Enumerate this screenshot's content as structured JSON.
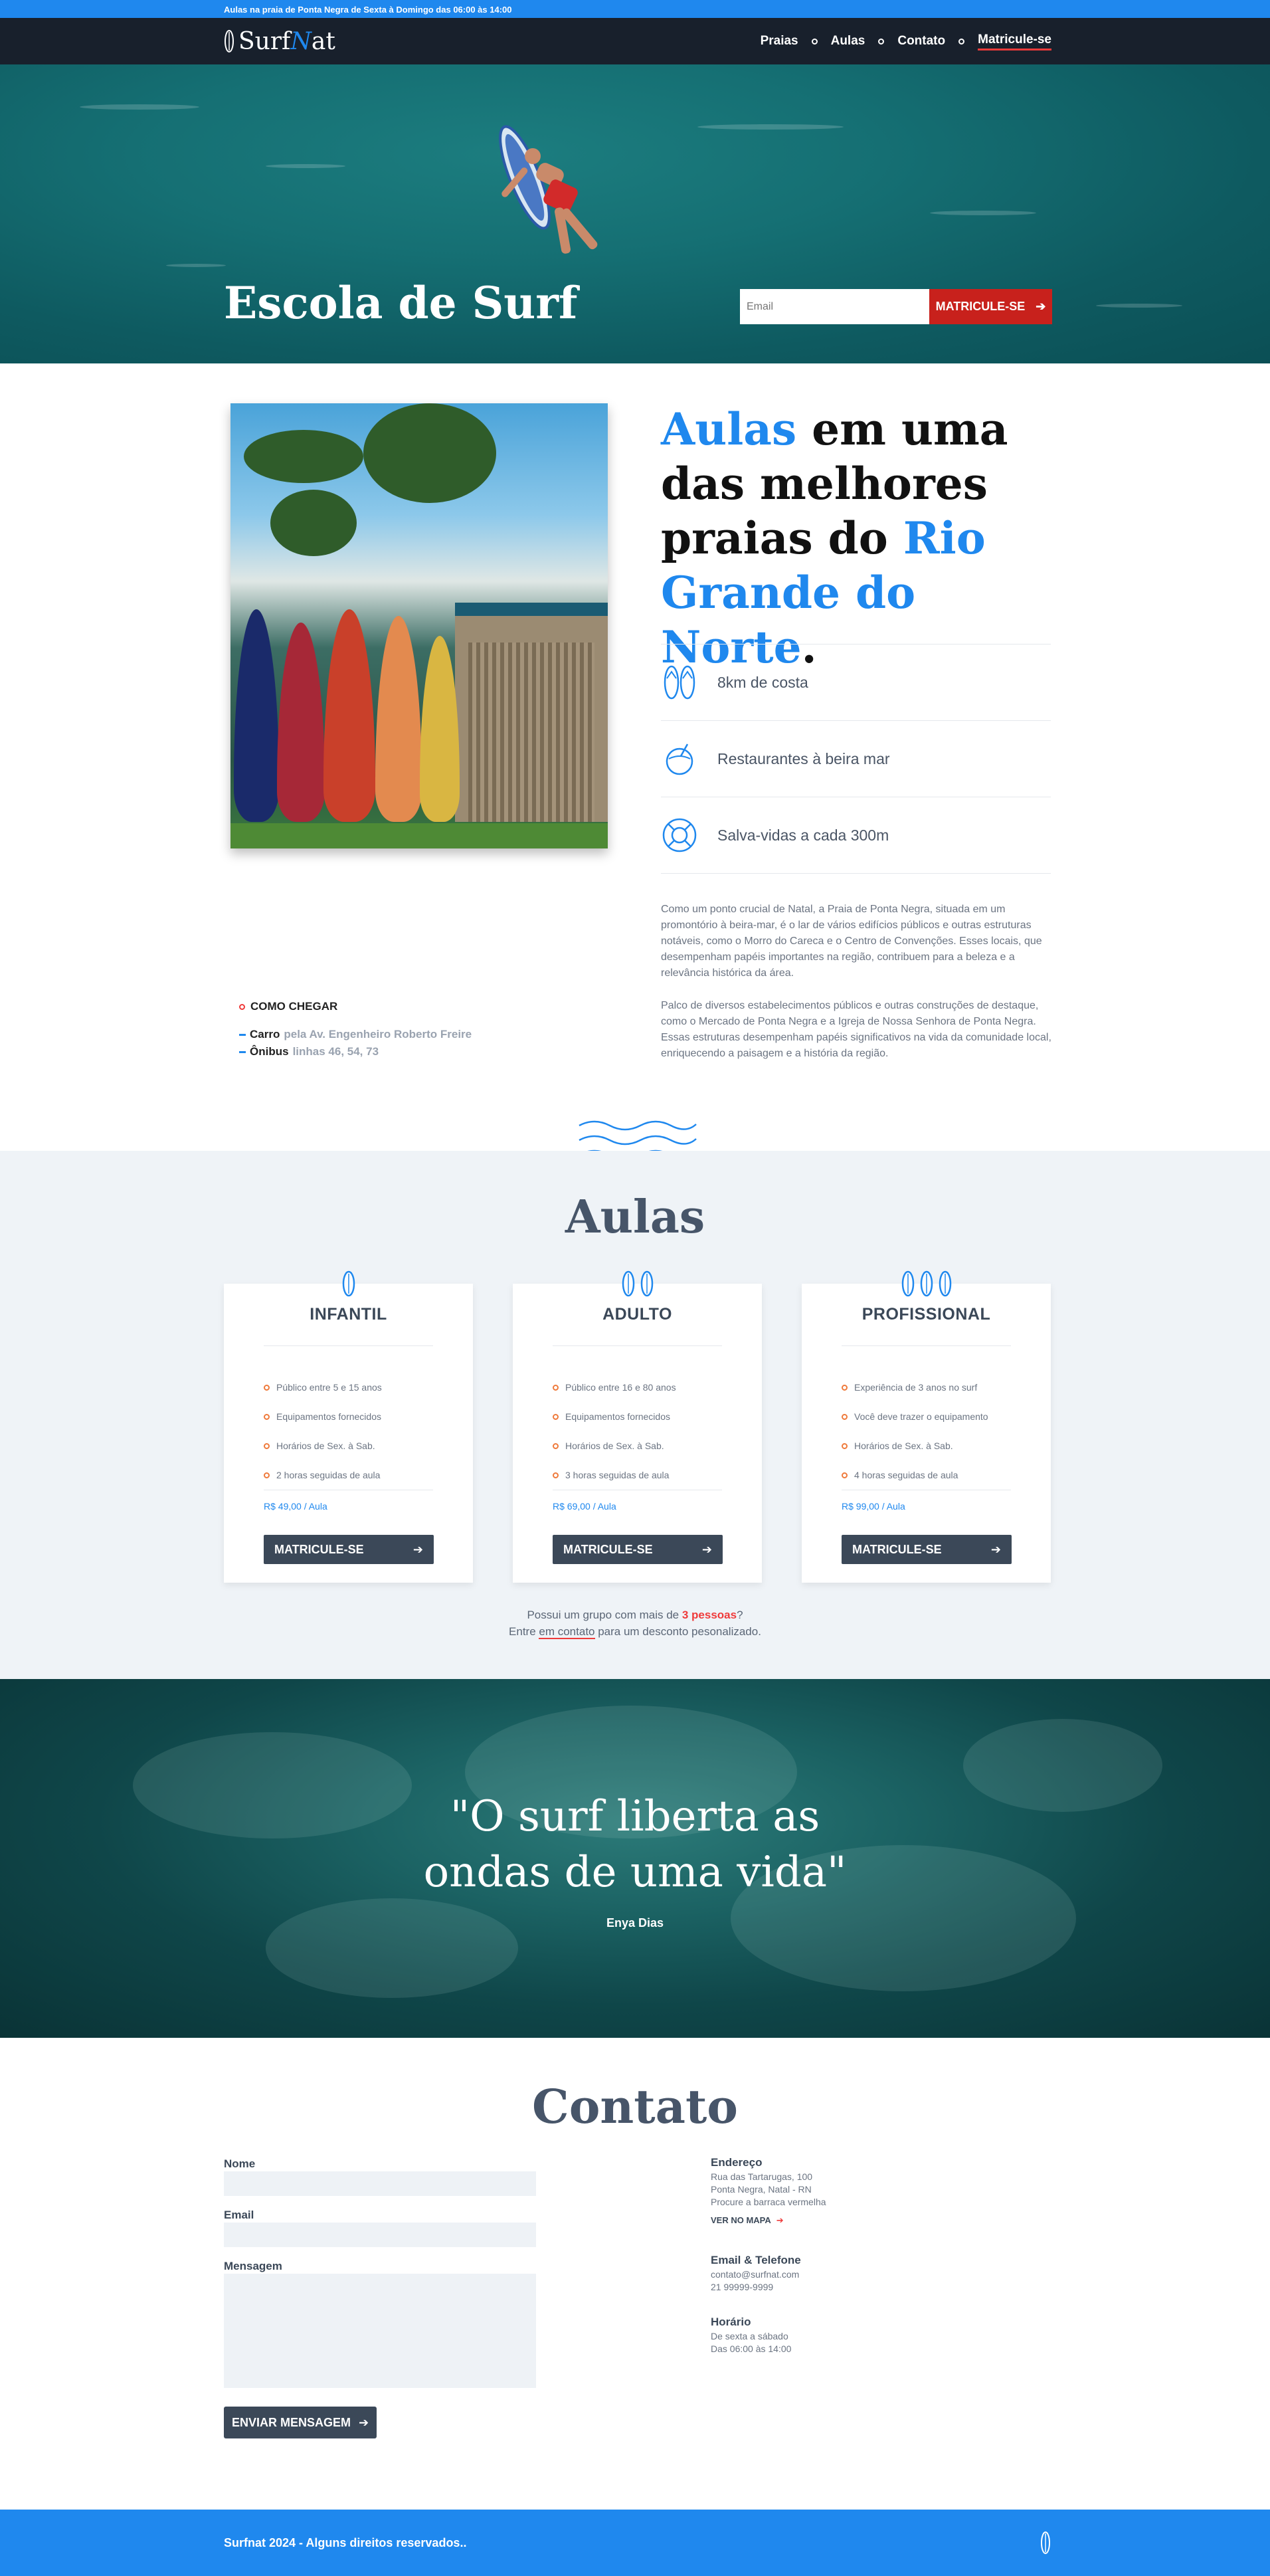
{
  "topbar": {
    "text": "Aulas na praia de Ponta Negra de Sexta à Domingo das 06:00 às 14:00"
  },
  "nav": {
    "logo_prefix": "Surf",
    "logo_n": "N",
    "logo_suffix": "at",
    "links": [
      "Praias",
      "Aulas",
      "Contato",
      "Matricule-se"
    ]
  },
  "hero": {
    "title": "Escola de Surf",
    "email_placeholder": "Email",
    "cta": "MATRICULE-SE"
  },
  "intro": {
    "headline": {
      "p1": "Aulas",
      "p2": " em uma das melhores praias do ",
      "p3": "Rio Grande do Norte",
      "p4": "."
    },
    "features": [
      {
        "icon": "flip-flops-icon",
        "label": "8km de costa"
      },
      {
        "icon": "coconut-drink-icon",
        "label": "Restaurantes à beira mar"
      },
      {
        "icon": "lifebuoy-icon",
        "label": "Salva-vidas a cada 300m"
      }
    ],
    "paragraphs": [
      "Como um ponto crucial de Natal, a Praia de Ponta Negra, situada em um promontório à beira-mar, é o lar de vários edifícios públicos e outras estruturas notáveis, como o Morro do Careca e o Centro de Convenções. Esses locais, que desempenham papéis importantes na região, contribuem para a beleza e a relevância histórica da área.",
      "Palco de diversos estabelecimentos públicos e outras construções de destaque, como o Mercado de Ponta Negra e a Igreja de Nossa Senhora de Ponta Negra. Essas estruturas desempenham papéis significativos na vida da comunidade local, enriquecendo a paisagem e a história da região."
    ],
    "route": {
      "heading": "COMO CHEGAR",
      "items": [
        {
          "label": "Carro",
          "detail": "pela Av. Engenheiro Roberto Freire"
        },
        {
          "label": "Ônibus",
          "detail": "linhas 46, 54, 73"
        }
      ]
    }
  },
  "aulas": {
    "title": "Aulas",
    "cards": [
      {
        "name": "INFANTIL",
        "boards": 1,
        "items": [
          "Público entre 5 e 15 anos",
          "Equipamentos fornecidos",
          "Horários de Sex. à Sab.",
          "2 horas seguidas de aula"
        ],
        "price": "R$ 49,00 / Aula",
        "cta": "MATRICULE-SE"
      },
      {
        "name": "ADULTO",
        "boards": 2,
        "items": [
          "Público entre 16 e 80 anos",
          "Equipamentos fornecidos",
          "Horários de Sex. à Sab.",
          "3 horas seguidas de aula"
        ],
        "price": "R$ 69,00 / Aula",
        "cta": "MATRICULE-SE"
      },
      {
        "name": "PROFISSIONAL",
        "boards": 3,
        "items": [
          "Experiência de 3 anos no surf",
          "Você deve trazer o equipamento",
          "Horários de Sex. à Sab.",
          "4 horas seguidas de aula"
        ],
        "price": "R$ 99,00 / Aula",
        "cta": "MATRICULE-SE"
      }
    ],
    "group_note": {
      "a": "Possui um grupo com mais de ",
      "b": "3 pessoas",
      "c": "?",
      "d": "Entre ",
      "e": "em contato",
      "f": " para um desconto pesonalizado."
    }
  },
  "quote": {
    "line1": "\"O surf liberta as",
    "line2": "ondas de uma vida\"",
    "author": "Enya Dias"
  },
  "contato": {
    "title": "Contato",
    "labels": {
      "name": "Nome",
      "email": "Email",
      "message": "Mensagem"
    },
    "send": "ENVIAR MENSAGEM",
    "address": {
      "heading": "Endereço",
      "lines": [
        "Rua das Tartarugas, 100",
        "Ponta Negra, Natal - RN",
        "Procure a barraca vermelha"
      ],
      "map": "VER NO MAPA"
    },
    "contact": {
      "heading": "Email & Telefone",
      "lines": [
        "contato@surfnat.com",
        "21 99999-9999"
      ]
    },
    "hours": {
      "heading": "Horário",
      "lines": [
        "De sexta a sábado",
        "Das 06:00 às 14:00"
      ]
    }
  },
  "footer": {
    "text": "Surfnat 2024 - Alguns direitos reservados.."
  },
  "colors": {
    "brand": "#1f88ee",
    "accent": "#ef3b3b",
    "dark": "#18202c",
    "cta": "#c8211c"
  }
}
